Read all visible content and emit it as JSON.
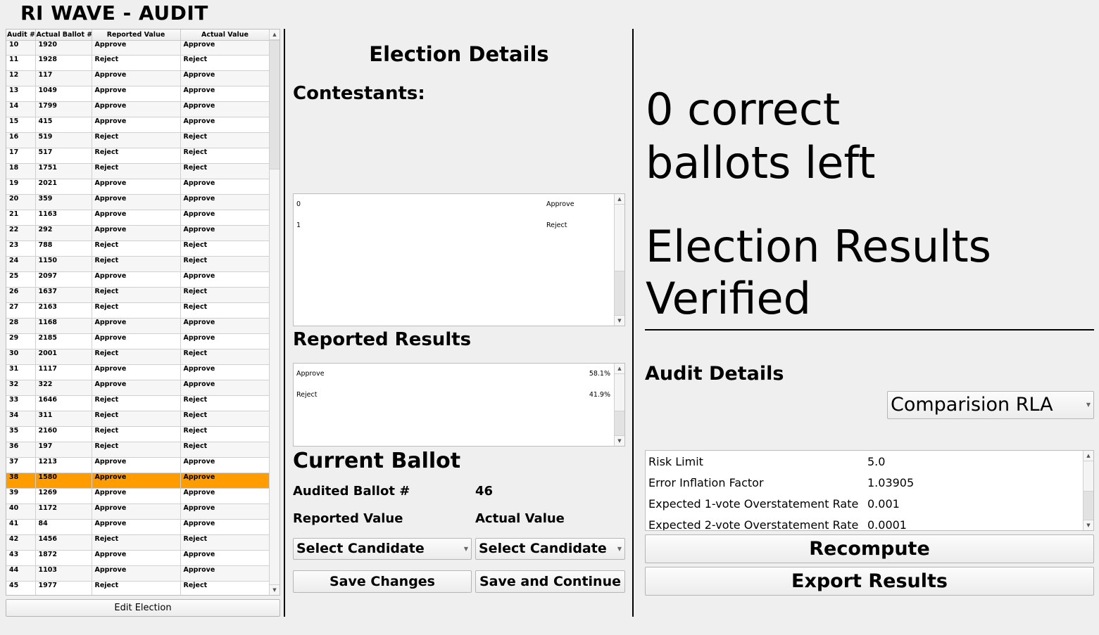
{
  "app": {
    "title": "RI WAVE - AUDIT"
  },
  "audit_table": {
    "columns": [
      "Audit #",
      "Actual Ballot #",
      "Reported Value",
      "Actual Value"
    ],
    "rows": [
      [
        "10",
        "1920",
        "Approve",
        "Approve"
      ],
      [
        "11",
        "1928",
        "Reject",
        "Reject"
      ],
      [
        "12",
        "117",
        "Approve",
        "Approve"
      ],
      [
        "13",
        "1049",
        "Approve",
        "Approve"
      ],
      [
        "14",
        "1799",
        "Approve",
        "Approve"
      ],
      [
        "15",
        "415",
        "Approve",
        "Approve"
      ],
      [
        "16",
        "519",
        "Reject",
        "Reject"
      ],
      [
        "17",
        "517",
        "Reject",
        "Reject"
      ],
      [
        "18",
        "1751",
        "Reject",
        "Reject"
      ],
      [
        "19",
        "2021",
        "Approve",
        "Approve"
      ],
      [
        "20",
        "359",
        "Approve",
        "Approve"
      ],
      [
        "21",
        "1163",
        "Approve",
        "Approve"
      ],
      [
        "22",
        "292",
        "Approve",
        "Approve"
      ],
      [
        "23",
        "788",
        "Reject",
        "Reject"
      ],
      [
        "24",
        "1150",
        "Reject",
        "Reject"
      ],
      [
        "25",
        "2097",
        "Approve",
        "Approve"
      ],
      [
        "26",
        "1637",
        "Reject",
        "Reject"
      ],
      [
        "27",
        "2163",
        "Reject",
        "Reject"
      ],
      [
        "28",
        "1168",
        "Approve",
        "Approve"
      ],
      [
        "29",
        "2185",
        "Approve",
        "Approve"
      ],
      [
        "30",
        "2001",
        "Reject",
        "Reject"
      ],
      [
        "31",
        "1117",
        "Approve",
        "Approve"
      ],
      [
        "32",
        "322",
        "Approve",
        "Approve"
      ],
      [
        "33",
        "1646",
        "Reject",
        "Reject"
      ],
      [
        "34",
        "311",
        "Reject",
        "Reject"
      ],
      [
        "35",
        "2160",
        "Reject",
        "Reject"
      ],
      [
        "36",
        "197",
        "Reject",
        "Reject"
      ],
      [
        "37",
        "1213",
        "Approve",
        "Approve"
      ],
      [
        "38",
        "1580",
        "Approve",
        "Approve"
      ],
      [
        "39",
        "1269",
        "Approve",
        "Approve"
      ],
      [
        "40",
        "1172",
        "Approve",
        "Approve"
      ],
      [
        "41",
        "84",
        "Approve",
        "Approve"
      ],
      [
        "42",
        "1456",
        "Reject",
        "Reject"
      ],
      [
        "43",
        "1872",
        "Approve",
        "Approve"
      ],
      [
        "44",
        "1103",
        "Approve",
        "Approve"
      ],
      [
        "45",
        "1977",
        "Reject",
        "Reject"
      ]
    ],
    "selected_audit_number": "38",
    "selected_color": "#ff9c00"
  },
  "left": {
    "edit_election_label": "Edit Election"
  },
  "election": {
    "title": "Election Details",
    "contestants_heading": "Contestants:",
    "contestants": [
      {
        "id": "0",
        "name": "Approve"
      },
      {
        "id": "1",
        "name": "Reject"
      }
    ],
    "reported_results_heading": "Reported Results",
    "reported_results": [
      {
        "name": "Approve",
        "percent": "58.1%"
      },
      {
        "name": "Reject",
        "percent": "41.9%"
      }
    ]
  },
  "current_ballot": {
    "heading": "Current Ballot",
    "audited_ballot_label": "Audited Ballot #",
    "audited_ballot_value": "46",
    "reported_value_label": "Reported Value",
    "actual_value_label": "Actual Value",
    "reported_select": "Select Candidate",
    "actual_select": "Select Candidate",
    "save_changes_label": "Save Changes",
    "save_continue_label": "Save and Continue"
  },
  "status": {
    "line1": "0 correct",
    "line2": "ballots left",
    "line3": "Election Results",
    "line4": "Verified"
  },
  "audit_details": {
    "heading": "Audit Details",
    "method_selected": "Comparision RLA",
    "params": [
      {
        "label": "Risk Limit",
        "value": "5.0"
      },
      {
        "label": "Error Inflation Factor",
        "value": "1.03905"
      },
      {
        "label": "Expected 1-vote Overstatement Rate",
        "value": "0.001"
      },
      {
        "label": "Expected 2-vote Overstatement Rate",
        "value": "0.0001"
      }
    ],
    "recompute_label": "Recompute",
    "export_label": "Export Results"
  }
}
